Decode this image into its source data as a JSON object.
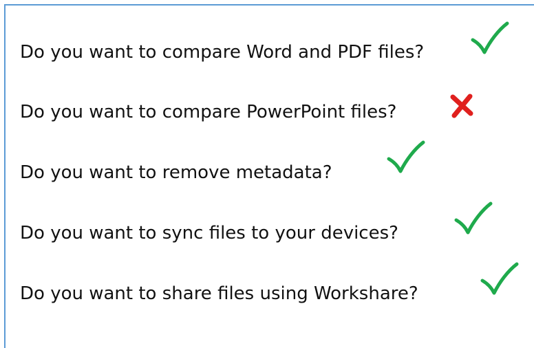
{
  "colors": {
    "border": "#5b9bd5",
    "check": "#1faa4c",
    "cross": "#e0201e"
  },
  "questions": [
    {
      "text": "Do you want to compare Word and PDF files?",
      "answer": "check-icon"
    },
    {
      "text": "Do you want to compare PowerPoint files?",
      "answer": "cross-icon"
    },
    {
      "text": "Do you want to remove metadata?",
      "answer": "check-icon"
    },
    {
      "text": "Do you want to sync files to your devices?",
      "answer": "check-icon"
    },
    {
      "text": "Do you want to share files using Workshare?",
      "answer": "check-icon"
    }
  ]
}
